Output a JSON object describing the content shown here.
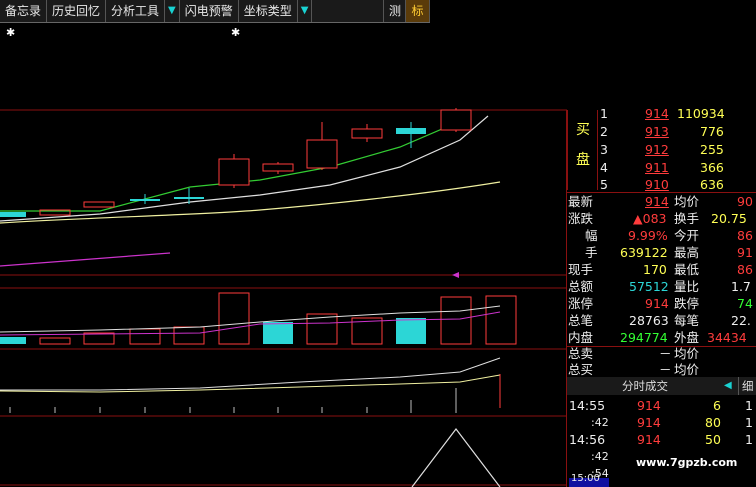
{
  "toolbar": {
    "items": [
      "备忘录",
      "历史回忆",
      "分析工具",
      "闪电预警",
      "坐标类型"
    ],
    "test_label": "测",
    "mark_label": "标"
  },
  "panel": {
    "buy_label_1": "买",
    "buy_label_2": "盘",
    "buy_levels": [
      {
        "level": "1",
        "price": "914",
        "vol": "110934"
      },
      {
        "level": "2",
        "price": "913",
        "vol": "776"
      },
      {
        "level": "3",
        "price": "912",
        "vol": "255"
      },
      {
        "level": "4",
        "price": "911",
        "vol": "366"
      },
      {
        "level": "5",
        "price": "910",
        "vol": "636"
      }
    ],
    "stats": [
      {
        "l1": "最新",
        "v1": "914",
        "l2": "均价",
        "v2": "90"
      },
      {
        "l1": "涨跌",
        "v1": "▲083",
        "l2": "换手",
        "v2": "20.75"
      },
      {
        "l1": "幅",
        "v1": "9.99%",
        "l2": "今开",
        "v2": "86"
      },
      {
        "l1": "手",
        "v1": "639122",
        "l2": "最高",
        "v2": "91"
      },
      {
        "l1": "现手",
        "v1": "170",
        "l2": "最低",
        "v2": "86"
      },
      {
        "l1": "总额",
        "v1": "57512",
        "l2": "量比",
        "v2": "1.7"
      },
      {
        "l1": "涨停",
        "v1": "914",
        "l2": "跌停",
        "v2": "74"
      },
      {
        "l1": "总笔",
        "v1": "28763",
        "l2": "每笔",
        "v2": "22."
      },
      {
        "l1": "内盘",
        "v1": "294774",
        "l2": "外盘",
        "v2": "34434"
      }
    ],
    "total_sell_label": "总卖",
    "total_sell_value": "－",
    "total_sell_avg": "均价",
    "total_buy_label": "总买",
    "total_buy_value": "－",
    "total_buy_avg": "均价",
    "tab_ticks": "分时成交",
    "tab_detail": "细",
    "ticks": [
      {
        "time": "14:55",
        "price": "914",
        "vol": "6",
        "n": "1"
      },
      {
        "time": ":42",
        "price": "914",
        "vol": "80",
        "n": "1"
      },
      {
        "time": "14:56",
        "price": "914",
        "vol": "50",
        "n": "1"
      },
      {
        "time": ":42",
        "price": "",
        "vol": "",
        "n": ""
      },
      {
        "time": ":54",
        "price": "",
        "vol": "",
        "n": ""
      }
    ],
    "bottom_time": "15:00"
  },
  "watermark": "www.7gpzb.com",
  "colors": {
    "up": "#ff3c3c",
    "down": "#2cd6d6",
    "ma_white": "#e0e0e0",
    "ma_yellow": "#f0f0a0",
    "ma_green": "#33cc33",
    "ma_purple": "#cc33cc",
    "frame": "#8a1010"
  }
}
